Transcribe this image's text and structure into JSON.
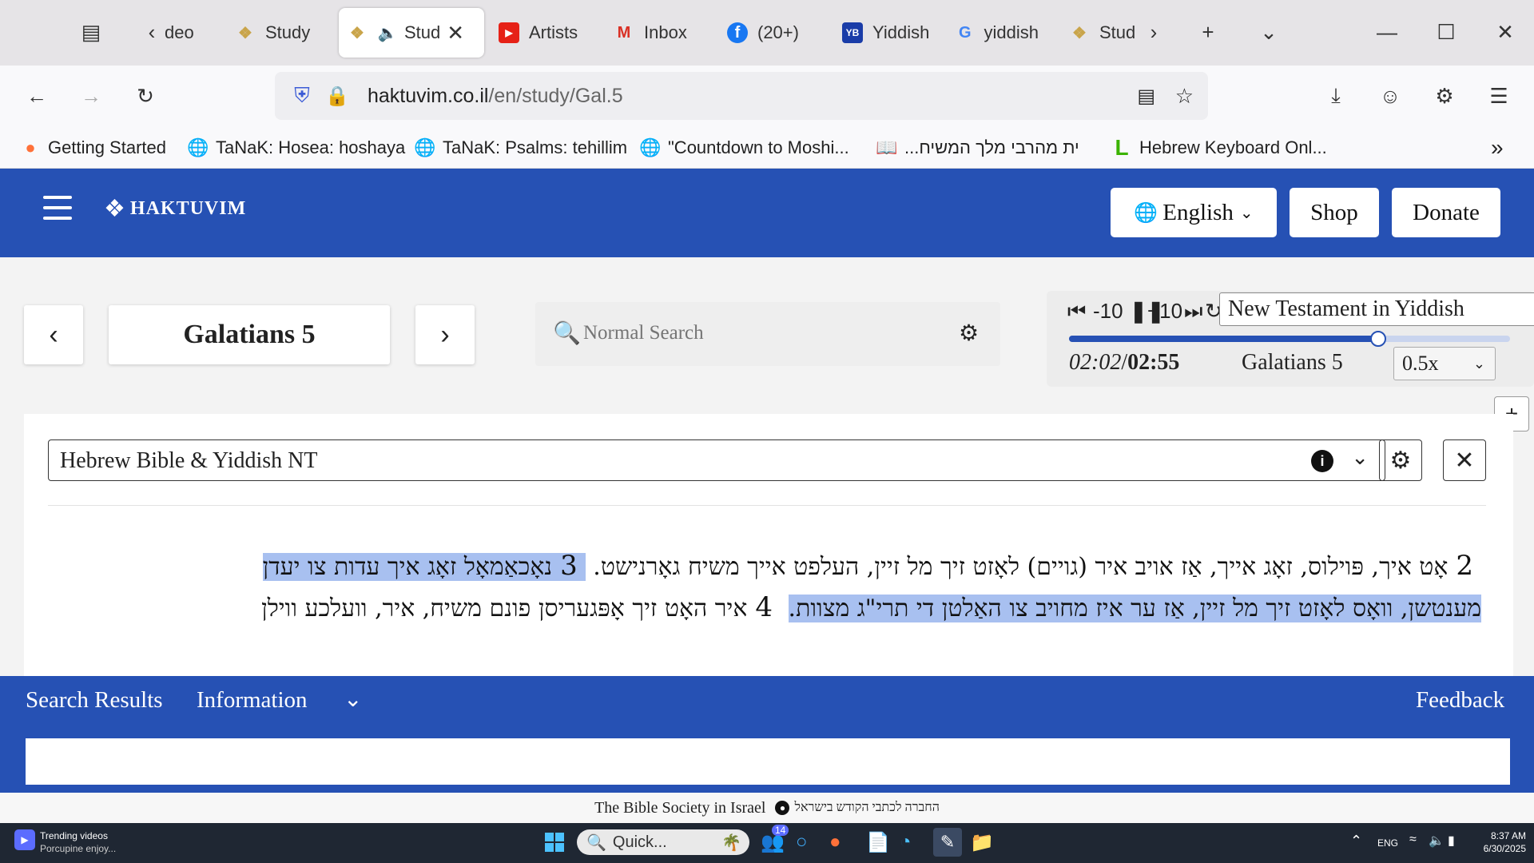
{
  "browser": {
    "tabs": [
      {
        "label": "deo",
        "icon": "video-icon"
      },
      {
        "label": "Study",
        "icon": "haktuvim-icon"
      },
      {
        "label": "Stud",
        "icon": "haktuvim-icon",
        "active": true
      },
      {
        "label": "Artists",
        "icon": "youtube-icon"
      },
      {
        "label": "Inbox",
        "icon": "gmail-icon"
      },
      {
        "label": "(20+)",
        "icon": "facebook-icon"
      },
      {
        "label": "Yiddish",
        "icon": "yb-icon"
      },
      {
        "label": "yiddish",
        "icon": "google-icon"
      },
      {
        "label": "Stud",
        "icon": "haktuvim-icon"
      }
    ],
    "url_host": "haktuvim.co.il",
    "url_path": "/en/study/Gal.5",
    "bookmarks": [
      {
        "label": "Getting Started",
        "icon": "firefox-icon"
      },
      {
        "label": "TaNaK: Hosea: hoshaya",
        "icon": "globe-icon"
      },
      {
        "label": "TaNaK: Psalms: tehillim",
        "icon": "globe-icon"
      },
      {
        "label": "\"Countdown to Moshi...",
        "icon": "globe-icon"
      },
      {
        "label": "...ית מהרבי מלך המשיח",
        "icon": "book-icon"
      },
      {
        "label": "Hebrew Keyboard Onl...",
        "icon": "l-icon"
      }
    ]
  },
  "site": {
    "logo_text": "HAKTUVIM",
    "language_label": "English",
    "shop_label": "Shop",
    "donate_label": "Donate",
    "chapter_title": "Galatians 5",
    "search_placeholder": "Normal Search",
    "audio": {
      "rewind_label": "-10",
      "forward_label": "+10",
      "version": "New Testament in Yiddish",
      "time_current": "02:02",
      "time_separator": "/",
      "time_total": "02:55",
      "progress": 0.697,
      "chapter_label": "Galatians 5",
      "speed": "0.5x"
    },
    "translation": "Hebrew Bible & Yiddish NT",
    "verses_line1": {
      "v2_num": "2",
      "v2_text": "אָט איך, פּוילוס, זאָג אייך, אַז אויב איר (גויים) לאָזט זיך מל זיין, העלפט אייך משיח גאָרנישט.",
      "v3_num": "3",
      "v3_text": "נאָכאַמאָל זאָג איך עדות צו יעדן"
    },
    "verses_line2": {
      "v3_cont": "מענטשן, וואָס לאָזט זיך מל זיין, אַז ער איז מחויב צו האַלטן די תרי\"ג מצוות.",
      "v4_num": "4",
      "v4_text": "איר האָט זיך אָפּגעריסן פונם משיח, איר, וועלכע ווילן"
    },
    "bottom_tabs": {
      "search_results": "Search Results",
      "information": "Information",
      "feedback": "Feedback"
    },
    "footer_text": "The Bible Society in Israel",
    "footer_hebrew": "החברה לכתבי הקודש בישראל"
  },
  "taskbar": {
    "widget_title": "Trending videos",
    "widget_subtitle": "Porcupine enjoy...",
    "search_label": "Quick...",
    "badge": "14",
    "lang": "ENG",
    "time": "8:37 AM",
    "date": "6/30/2025"
  },
  "colors": {
    "brand_blue": "#2651b4",
    "highlight": "#a8c0f0"
  }
}
